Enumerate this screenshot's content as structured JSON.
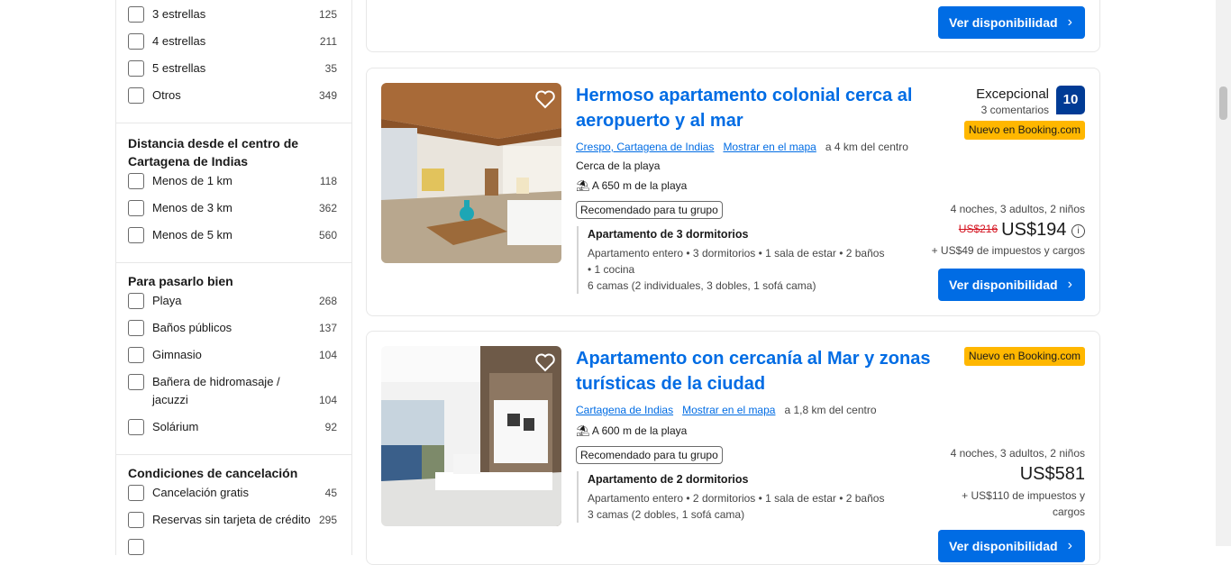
{
  "filters": {
    "stars": [
      {
        "label": "3 estrellas",
        "count": "125"
      },
      {
        "label": "4 estrellas",
        "count": "211"
      },
      {
        "label": "5 estrellas",
        "count": "35"
      },
      {
        "label": "Otros",
        "count": "349"
      }
    ],
    "distance_title": "Distancia desde el centro de Cartagena de Indias",
    "distance": [
      {
        "label": "Menos de 1 km",
        "count": "118"
      },
      {
        "label": "Menos de 3 km",
        "count": "362"
      },
      {
        "label": "Menos de 5 km",
        "count": "560"
      }
    ],
    "fun_title": "Para pasarlo bien",
    "fun": [
      {
        "label": "Playa",
        "count": "268"
      },
      {
        "label": "Baños públicos",
        "count": "137"
      },
      {
        "label": "Gimnasio",
        "count": "104"
      },
      {
        "label": "Bañera de hidromasaje / jacuzzi",
        "count": "104"
      },
      {
        "label": "Solárium",
        "count": "92"
      }
    ],
    "cancel_title": "Condiciones de cancelación",
    "cancel": [
      {
        "label": "Cancelación gratis",
        "count": "45"
      },
      {
        "label": "Reservas sin tarjeta de crédito",
        "count": "295"
      }
    ]
  },
  "button_label": "Ver disponibilidad",
  "recommended_label": "Recomendado para tu grupo",
  "new_badge": "Nuevo en Booking.com",
  "map_link": "Mostrar en el mapa",
  "card1": {
    "title": "Hermoso apartamento colonial cerca al aeropuerto y al mar",
    "area": "Crespo, Cartagena de Indias",
    "distance": "a 4 km del centro",
    "near_beach": "Cerca de la playa",
    "beach": "A 650 m de la playa",
    "unit_name": "Apartamento de 3 dormitorios",
    "unit_desc1": "Apartamento entero • 3 dormitorios • 1 sala de estar • 2 baños",
    "unit_desc2": "• 1 cocina",
    "unit_beds": "6 camas (2 individuales, 3 dobles, 1 sofá cama)",
    "rating_word": "Excepcional",
    "reviews": "3 comentarios",
    "score": "10",
    "stay": "4 noches, 3 adultos, 2 niños",
    "old_price": "US$216",
    "price": "US$194",
    "taxes": "+ US$49 de impuestos y cargos"
  },
  "card2": {
    "title": "Apartamento con cercanía al Mar y zonas turísticas de la ciudad",
    "area": "Cartagena de Indias",
    "distance": "a 1,8 km del centro",
    "beach": "A 600 m de la playa",
    "unit_name": "Apartamento de 2 dormitorios",
    "unit_desc1": "Apartamento entero • 2 dormitorios • 1 sala de estar • 2 baños",
    "unit_beds": "3 camas (2 dobles, 1 sofá cama)",
    "stay": "4 noches, 3 adultos, 2 niños",
    "price": "US$581",
    "taxes1": "+ US$110 de impuestos y",
    "taxes2": "cargos"
  }
}
